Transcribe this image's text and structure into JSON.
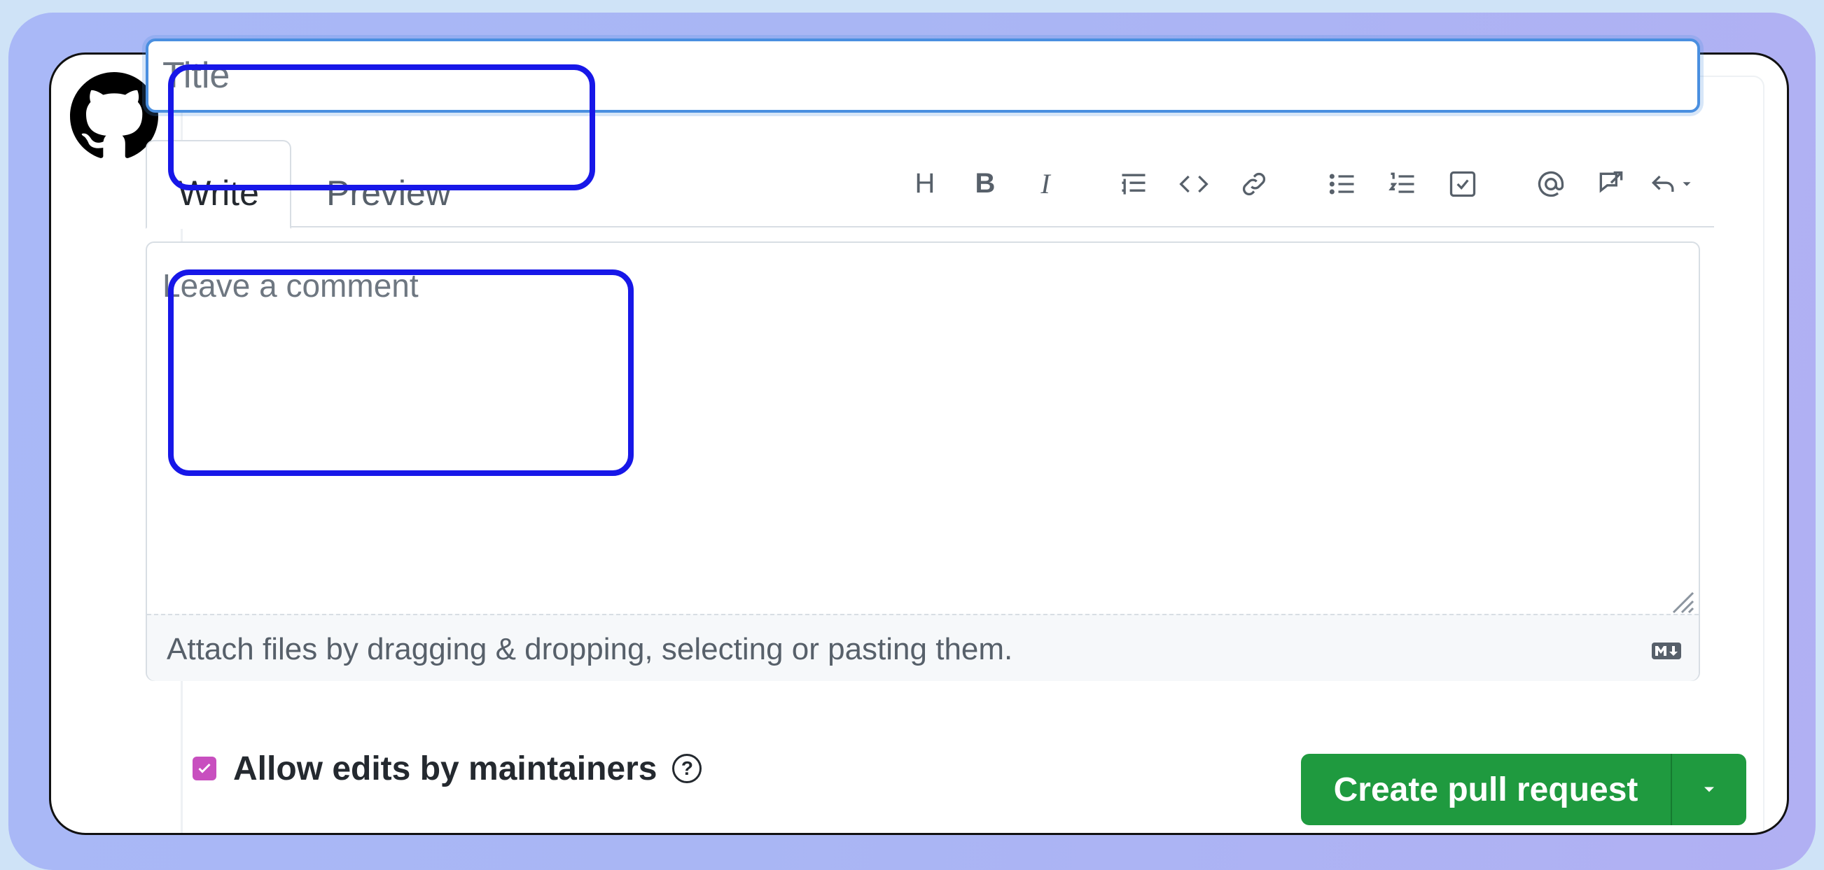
{
  "title_field": {
    "placeholder": "Title"
  },
  "tabs": [
    {
      "label": "Write",
      "active": true
    },
    {
      "label": "Preview",
      "active": false
    }
  ],
  "toolbar": {
    "icons": [
      "heading-icon",
      "bold-icon",
      "italic-icon",
      "quote-icon",
      "code-icon",
      "link-icon",
      "unordered-list-icon",
      "ordered-list-icon",
      "task-list-icon",
      "mention-icon",
      "reference-icon",
      "reply-icon"
    ],
    "heading_glyph": "H",
    "bold_glyph": "B",
    "italic_glyph": "I"
  },
  "comment": {
    "placeholder": "Leave a comment",
    "attach_hint": "Attach files by dragging & dropping, selecting or pasting them."
  },
  "allow_edits": {
    "label": "Allow edits by maintainers",
    "checked": true,
    "help_glyph": "?"
  },
  "submit": {
    "label": "Create pull request"
  },
  "colors": {
    "accent_green": "#1f9a3f",
    "highlight_blue": "#1717e8",
    "focus_blue": "#4a8fe0",
    "checkbox": "#c84fbf"
  }
}
